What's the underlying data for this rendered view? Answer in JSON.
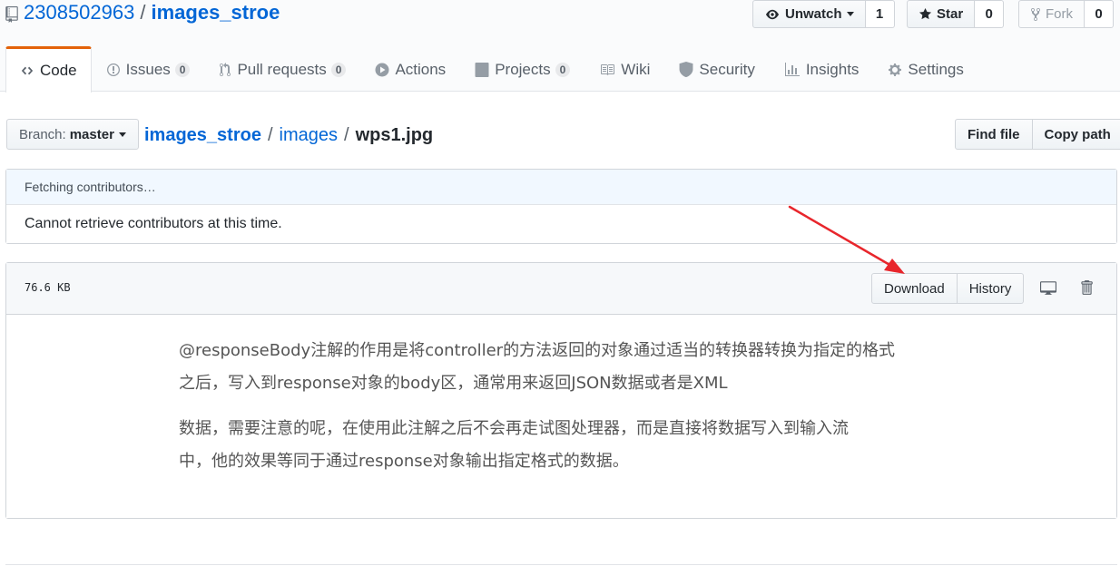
{
  "repo": {
    "owner": "2308502963",
    "separator": "/",
    "name": "images_stroe"
  },
  "actions": {
    "unwatch_label": "Unwatch",
    "watch_count": "1",
    "star_label": "Star",
    "star_count": "0",
    "fork_label": "Fork",
    "fork_count": "0"
  },
  "tabs": [
    {
      "label": "Code",
      "icon": "code-icon",
      "selected": true
    },
    {
      "label": "Issues",
      "badge": "0",
      "icon": "issue-icon"
    },
    {
      "label": "Pull requests",
      "badge": "0",
      "icon": "pull-request-icon"
    },
    {
      "label": "Actions",
      "icon": "play-icon"
    },
    {
      "label": "Projects",
      "badge": "0",
      "icon": "project-icon"
    },
    {
      "label": "Wiki",
      "icon": "book-icon"
    },
    {
      "label": "Security",
      "icon": "shield-icon"
    },
    {
      "label": "Insights",
      "icon": "graph-icon"
    },
    {
      "label": "Settings",
      "icon": "gear-icon"
    }
  ],
  "branch": {
    "label": "Branch:",
    "value": "master"
  },
  "breadcrumb": {
    "root": "images_stroe",
    "sep1": "/",
    "folder": "images",
    "sep2": "/",
    "file": "wps1.jpg"
  },
  "file_nav": {
    "find_file": "Find file",
    "copy_path": "Copy path"
  },
  "contributors": {
    "fetching": "Fetching contributors…",
    "error": "Cannot retrieve contributors at this time."
  },
  "file": {
    "size": "76.6 KB",
    "download": "Download",
    "history": "History",
    "display_icon": "desktop-icon",
    "delete_icon": "trash-icon"
  },
  "image_text": {
    "line1": "@responseBody注解的作用是将controller的方法返回的对象通过适当的转换器转换为指定的格式",
    "line2": "之后，写入到response对象的body区，通常用来返回JSON数据或者是XML",
    "line3": "数据，需要注意的呢，在使用此注解之后不会再走试图处理器，而是直接将数据写入到输入流",
    "line4": "中，他的效果等同于通过response对象输出指定格式的数据。"
  },
  "colors": {
    "link": "#0366d6",
    "tab_accent": "#e36209",
    "annotation_arrow": "#e8262c"
  }
}
